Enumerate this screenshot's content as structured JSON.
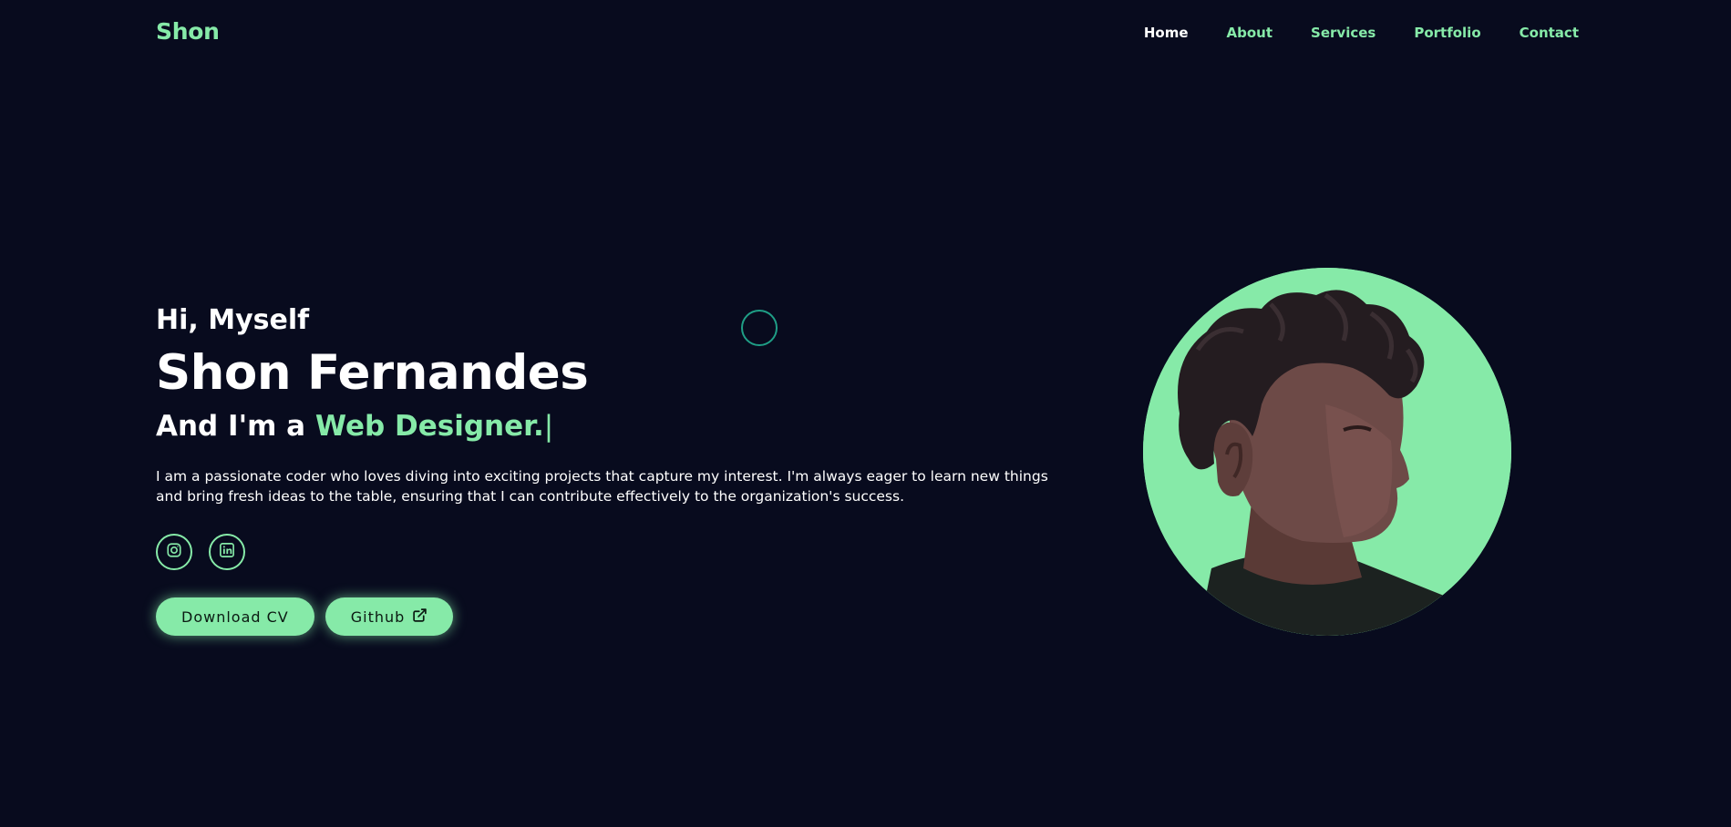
{
  "header": {
    "logo": "Shon",
    "nav": [
      {
        "label": "Home",
        "active": true
      },
      {
        "label": "About",
        "active": false
      },
      {
        "label": "Services",
        "active": false
      },
      {
        "label": "Portfolio",
        "active": false
      },
      {
        "label": "Contact",
        "active": false
      }
    ]
  },
  "hero": {
    "greeting": "Hi, Myself",
    "name": "Shon Fernandes",
    "role_prefix": "And I'm a",
    "role_highlight": "Web Designer.",
    "role_cursor": "|",
    "description": "I am a passionate coder who loves diving into exciting projects that capture my interest. I'm always eager to learn new things and bring fresh ideas to the table, ensuring that I can contribute effectively to the organization's success.",
    "social": [
      {
        "icon": "instagram-icon"
      },
      {
        "icon": "linkedin-icon"
      }
    ],
    "buttons": {
      "download_cv": "Download CV",
      "github": "Github",
      "github_icon": "external-link-icon"
    },
    "portrait_icon": "profile-photo"
  },
  "colors": {
    "background": "#080b1e",
    "accent": "#86eaa8",
    "text": "#ffffff",
    "ring": "#1f9e86"
  }
}
